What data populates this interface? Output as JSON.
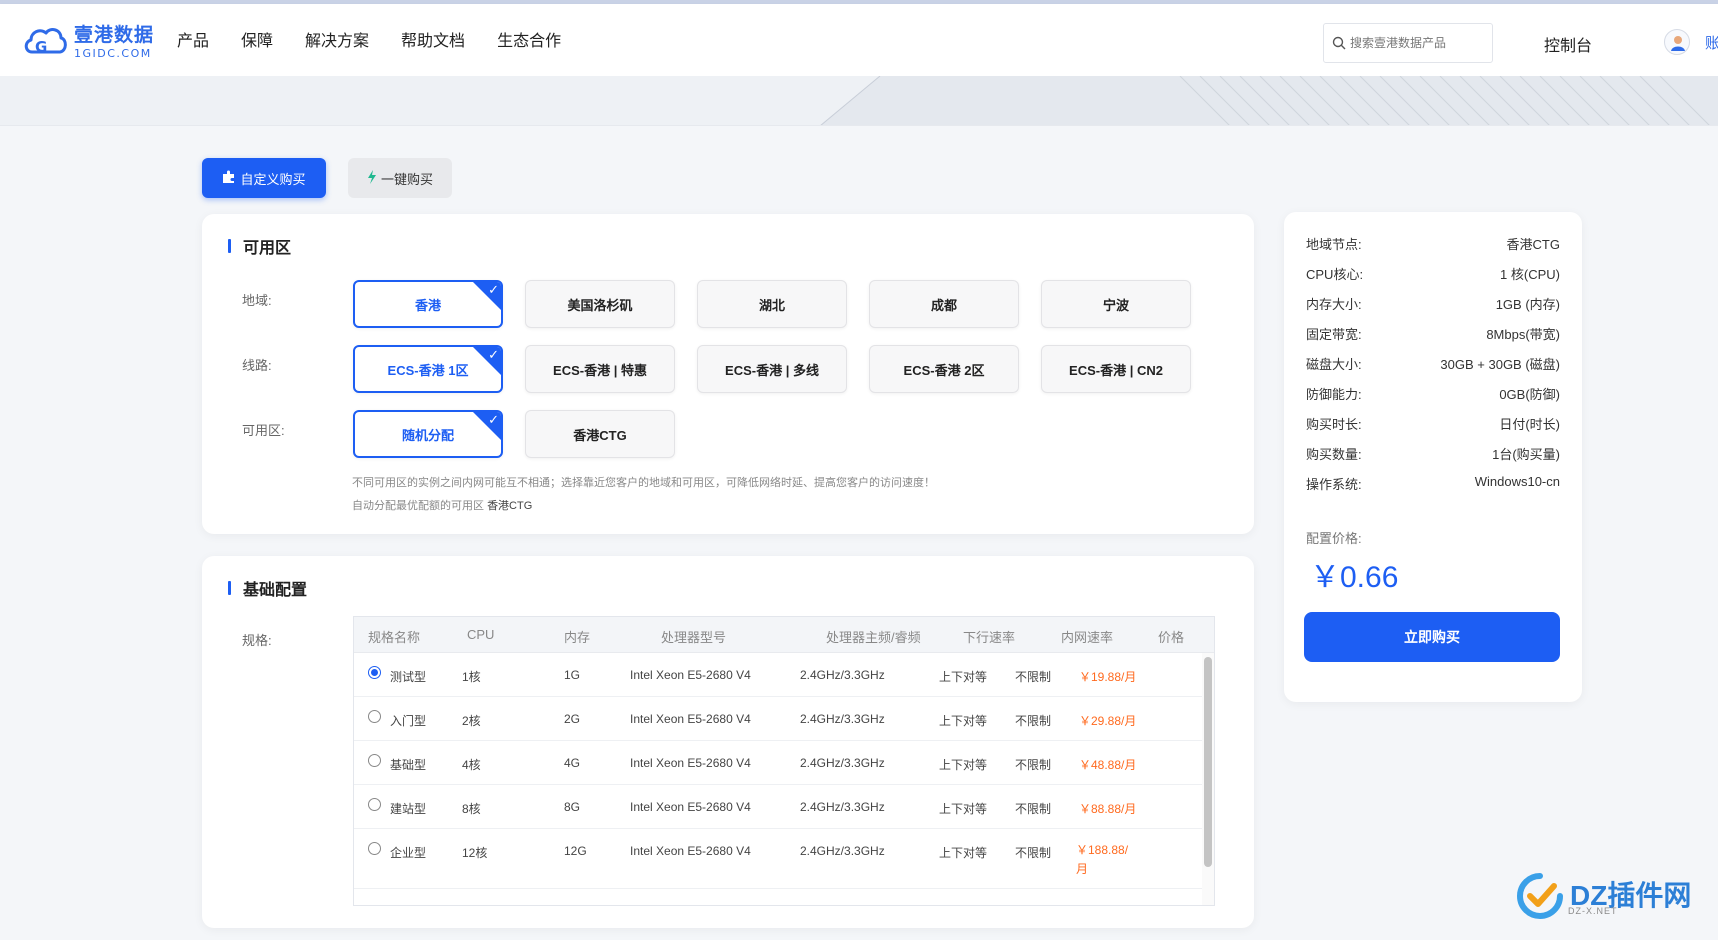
{
  "header": {
    "logo_cn": "壹港数据",
    "logo_en": "1GIDC.COM",
    "nav": [
      "产品",
      "保障",
      "解决方案",
      "帮助文档",
      "生态合作"
    ],
    "search_placeholder": "搜索壹港数据产品",
    "console": "控制台",
    "account": "账"
  },
  "tabs": {
    "custom": "自定义购买",
    "quick": "一键购买"
  },
  "zone": {
    "title": "可用区",
    "region_label": "地域:",
    "regions": [
      "香港",
      "美国洛杉矶",
      "湖北",
      "成都",
      "宁波"
    ],
    "line_label": "线路:",
    "lines": [
      "ECS-香港 1区",
      "ECS-香港 | 特惠",
      "ECS-香港 | 多线",
      "ECS-香港 2区",
      "ECS-香港 | CN2"
    ],
    "az_label": "可用区:",
    "azs": [
      "随机分配",
      "香港CTG"
    ],
    "note1": "不同可用区的实例之间内网可能互不相通；选择靠近您客户的地域和可用区，可降低网络时延、提高您客户的访问速度！",
    "note2_prefix": "自动分配最优配额的可用区",
    "note2_value": "香港CTG"
  },
  "base": {
    "title": "基础配置",
    "spec_label": "规格:",
    "columns": [
      "规格名称",
      "CPU",
      "内存",
      "处理器型号",
      "处理器主频/睿频",
      "下行速率",
      "内网速率",
      "价格"
    ],
    "rows": [
      {
        "name": "测试型",
        "cpu": "1核",
        "mem": "1G",
        "model": "Intel Xeon E5-2680 V4",
        "freq": "2.4GHz/3.3GHz",
        "down": "上下对等",
        "intranet": "不限制",
        "price": "￥19.88/月"
      },
      {
        "name": "入门型",
        "cpu": "2核",
        "mem": "2G",
        "model": "Intel Xeon E5-2680 V4",
        "freq": "2.4GHz/3.3GHz",
        "down": "上下对等",
        "intranet": "不限制",
        "price": "￥29.88/月"
      },
      {
        "name": "基础型",
        "cpu": "4核",
        "mem": "4G",
        "model": "Intel Xeon E5-2680 V4",
        "freq": "2.4GHz/3.3GHz",
        "down": "上下对等",
        "intranet": "不限制",
        "price": "￥48.88/月"
      },
      {
        "name": "建站型",
        "cpu": "8核",
        "mem": "8G",
        "model": "Intel Xeon E5-2680 V4",
        "freq": "2.4GHz/3.3GHz",
        "down": "上下对等",
        "intranet": "不限制",
        "price": "￥88.88/月"
      },
      {
        "name": "企业型",
        "cpu": "12核",
        "mem": "12G",
        "model": "Intel Xeon E5-2680 V4",
        "freq": "2.4GHz/3.3GHz",
        "down": "上下对等",
        "intranet": "不限制",
        "price": "￥188.88/月"
      }
    ]
  },
  "summary": {
    "items": [
      {
        "k": "地域节点:",
        "v": "香港CTG"
      },
      {
        "k": "CPU核心:",
        "v": "1 核(CPU)"
      },
      {
        "k": "内存大小:",
        "v": "1GB (内存)"
      },
      {
        "k": "固定带宽:",
        "v": "8Mbps(带宽)"
      },
      {
        "k": "磁盘大小:",
        "v": "30GB + 30GB (磁盘)"
      },
      {
        "k": "防御能力:",
        "v": "0GB(防御)"
      },
      {
        "k": "购买时长:",
        "v": "日付(时长)"
      },
      {
        "k": "购买数量:",
        "v": "1台(购买量)"
      },
      {
        "k": "操作系统:",
        "v": "Windows10-cn"
      }
    ],
    "config_price_label": "配置价格:",
    "price": "￥0.66",
    "buy": "立即购买"
  },
  "watermark": {
    "text": "DZ插件网",
    "sub": "DZ-X.NET"
  },
  "colors": {
    "primary": "#1d5ef3",
    "price": "#ff6a1f"
  }
}
